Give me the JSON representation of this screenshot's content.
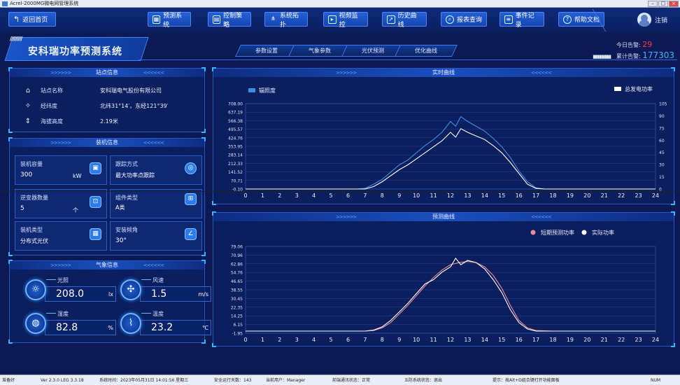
{
  "window": {
    "title": "Acrel-2000MG微电网管理系统"
  },
  "nav": {
    "back_label": "返回首页",
    "items": [
      {
        "label": "预测系统",
        "icon": "chart-icon"
      },
      {
        "label": "控制策略",
        "icon": "strategy-icon"
      },
      {
        "label": "系统拓扑",
        "icon": "topology-icon"
      },
      {
        "label": "视频监控",
        "icon": "video-icon"
      },
      {
        "label": "历史曲线",
        "icon": "history-icon"
      },
      {
        "label": "报表查询",
        "icon": "search-icon"
      },
      {
        "label": "事件记录",
        "icon": "event-icon"
      },
      {
        "label": "帮助文档",
        "icon": "help-icon"
      }
    ],
    "logout_label": "注销"
  },
  "header": {
    "title": "安科瑞功率预测系统",
    "tabs": [
      "参数设置",
      "气象参数",
      "光伏预测",
      "优化曲线"
    ],
    "alarm_today_label": "今日告警:",
    "alarm_today_value": "29",
    "alarm_total_label": "累计告警:",
    "alarm_total_value": "177303"
  },
  "site": {
    "title": "站点信息",
    "rows": [
      {
        "label": "站点名称",
        "value": "安科瑞电气股份有限公司",
        "icon": "home-icon"
      },
      {
        "label": "经纬度",
        "value": "北纬31°14′，东经121°39′",
        "icon": "compass-icon"
      },
      {
        "label": "海拔高度",
        "value": "2.19米",
        "icon": "altitude-icon"
      }
    ]
  },
  "equipment": {
    "title": "装机信息",
    "cards": [
      {
        "label": "装机容量",
        "value": "300",
        "unit": "kW",
        "icon": "capacity-icon"
      },
      {
        "label": "跟踪方式",
        "value": "最大功率点跟踪",
        "unit": "",
        "icon": "tracking-icon"
      },
      {
        "label": "逆变器数量",
        "value": "5",
        "unit": "个",
        "icon": "inverter-icon"
      },
      {
        "label": "组件类型",
        "value": "A类",
        "unit": "",
        "icon": "module-icon"
      },
      {
        "label": "装机类型",
        "value": "分布式光伏",
        "unit": "",
        "icon": "grid-icon"
      },
      {
        "label": "安装倾角",
        "value": "30°",
        "unit": "",
        "icon": "angle-icon"
      }
    ]
  },
  "weather": {
    "title": "气象信息",
    "items": [
      {
        "label": "光照",
        "value": "208.0",
        "unit": "lx",
        "icon": "sun-icon"
      },
      {
        "label": "风速",
        "value": "1.5",
        "unit": "m/s",
        "icon": "wind-icon"
      },
      {
        "label": "湿度",
        "value": "82.8",
        "unit": "%",
        "icon": "humidity-icon"
      },
      {
        "label": "温度",
        "value": "23.2",
        "unit": "℃",
        "icon": "temperature-icon"
      }
    ]
  },
  "status": {
    "ready": "准备好",
    "version": "Ver 2.3.0 LEG 3.3.18",
    "system_time": "系统时间：2023年05月31日  14:01:56  星期三",
    "safe_days": "安全运行天数：143",
    "user": "当前用户：Manager",
    "comm": "前端通讯状态：正常",
    "five_defense": "五防系统状态：退出",
    "hint": "提示：按Alt+D组合键打开功能面板",
    "num": "NUM"
  },
  "chart_data": [
    {
      "type": "line",
      "title": "实时曲线",
      "legend": [
        "辐照度",
        "总发电功率"
      ],
      "x": [
        0,
        1,
        2,
        3,
        4,
        5,
        6,
        7,
        8,
        9,
        10,
        11,
        12,
        13,
        14,
        15,
        16,
        17,
        18,
        19,
        20,
        21,
        22,
        23,
        24
      ],
      "yleft_ticks": [
        "708.00",
        "637.19",
        "566.38",
        "495.57",
        "424.76",
        "353.95",
        "283.14",
        "212.33",
        "141.52",
        "70.71",
        "-0.10"
      ],
      "yright_ticks": [
        "105",
        "90",
        "75",
        "60",
        "45",
        "30",
        "15",
        "0"
      ],
      "series": [
        {
          "name": "辐照度",
          "color": "#3e8ee6",
          "axis": "left",
          "points": [
            [
              0,
              0
            ],
            [
              6.5,
              0
            ],
            [
              7,
              5
            ],
            [
              7.5,
              40
            ],
            [
              8,
              80
            ],
            [
              8.5,
              140
            ],
            [
              9,
              200
            ],
            [
              9.5,
              240
            ],
            [
              10,
              300
            ],
            [
              10.5,
              360
            ],
            [
              11,
              410
            ],
            [
              11.5,
              470
            ],
            [
              12,
              560
            ],
            [
              12.3,
              520
            ],
            [
              12.6,
              600
            ],
            [
              13,
              560
            ],
            [
              13.5,
              520
            ],
            [
              14,
              480
            ],
            [
              14.5,
              420
            ],
            [
              15,
              350
            ],
            [
              15.5,
              260
            ],
            [
              16,
              150
            ],
            [
              16.5,
              60
            ],
            [
              17,
              10
            ],
            [
              17.5,
              0
            ],
            [
              24,
              0
            ]
          ]
        },
        {
          "name": "总发电功率",
          "color": "#ffffff",
          "axis": "left",
          "points": [
            [
              0,
              0
            ],
            [
              7,
              0
            ],
            [
              7.5,
              20
            ],
            [
              8,
              60
            ],
            [
              8.5,
              110
            ],
            [
              9,
              160
            ],
            [
              9.5,
              200
            ],
            [
              10,
              250
            ],
            [
              10.5,
              300
            ],
            [
              11,
              350
            ],
            [
              11.5,
              400
            ],
            [
              12,
              470
            ],
            [
              12.3,
              430
            ],
            [
              12.6,
              500
            ],
            [
              13,
              470
            ],
            [
              13.5,
              440
            ],
            [
              14,
              410
            ],
            [
              14.5,
              360
            ],
            [
              15,
              300
            ],
            [
              15.5,
              220
            ],
            [
              16,
              130
            ],
            [
              16.5,
              40
            ],
            [
              17,
              5
            ],
            [
              17.5,
              0
            ],
            [
              24,
              0
            ]
          ]
        }
      ]
    },
    {
      "type": "line",
      "title": "预测曲线",
      "legend": [
        "短期预测功率",
        "实际功率"
      ],
      "x": [
        0,
        1,
        2,
        3,
        4,
        5,
        6,
        7,
        8,
        9,
        10,
        11,
        12,
        13,
        14,
        15,
        16,
        17,
        18,
        19,
        20,
        21,
        22,
        23,
        24
      ],
      "y_ticks": [
        "79.06",
        "70.96",
        "62.86",
        "54.76",
        "46.65",
        "38.55",
        "30.45",
        "22.35",
        "14.25",
        "6.15",
        "-1.95"
      ],
      "series": [
        {
          "name": "短期预测功率",
          "color": "#f08a9a",
          "points": [
            [
              0,
              0
            ],
            [
              7,
              0
            ],
            [
              7.5,
              0.5
            ],
            [
              8,
              3
            ],
            [
              8.5,
              8
            ],
            [
              9,
              16
            ],
            [
              9.5,
              24
            ],
            [
              10,
              33
            ],
            [
              10.5,
              42
            ],
            [
              11,
              50
            ],
            [
              11.5,
              57
            ],
            [
              12,
              62
            ],
            [
              12.5,
              64
            ],
            [
              13,
              65
            ],
            [
              13.5,
              64
            ],
            [
              14,
              60
            ],
            [
              14.5,
              52
            ],
            [
              15,
              40
            ],
            [
              15.5,
              24
            ],
            [
              16,
              10
            ],
            [
              16.5,
              3
            ],
            [
              17,
              0.5
            ],
            [
              18,
              0
            ],
            [
              24,
              0
            ]
          ]
        },
        {
          "name": "实际功率",
          "color": "#ffffff",
          "points": [
            [
              0,
              0
            ],
            [
              7,
              0
            ],
            [
              7.5,
              1
            ],
            [
              8,
              4
            ],
            [
              8.5,
              10
            ],
            [
              9,
              18
            ],
            [
              9.5,
              26
            ],
            [
              10,
              35
            ],
            [
              10.5,
              44
            ],
            [
              11,
              48
            ],
            [
              11.5,
              55
            ],
            [
              12,
              60
            ],
            [
              12.3,
              68
            ],
            [
              12.6,
              62
            ],
            [
              13,
              66
            ],
            [
              13.5,
              64
            ],
            [
              14,
              58
            ],
            [
              14.5,
              48
            ],
            [
              15,
              36
            ],
            [
              15.5,
              20
            ],
            [
              16,
              8
            ],
            [
              16.5,
              2
            ],
            [
              17,
              0
            ],
            [
              24,
              0
            ]
          ]
        }
      ]
    }
  ]
}
